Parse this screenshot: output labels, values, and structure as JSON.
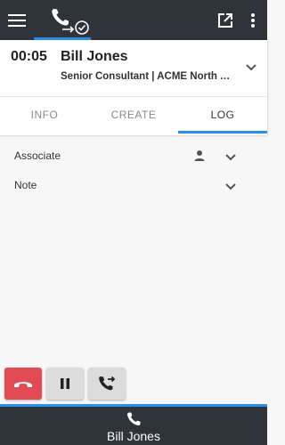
{
  "header": {
    "menu_icon": "hamburger-menu-icon",
    "phone_icon": "phone-check-icon",
    "popout_icon": "open-external-icon",
    "more_icon": "more-vertical-icon"
  },
  "call": {
    "timer": "00:05",
    "name": "Bill Jones",
    "subtitle": "Senior Consultant | ACME North A..."
  },
  "tabs": [
    {
      "label": "INFO"
    },
    {
      "label": "CREATE"
    },
    {
      "label": "LOG",
      "active": true
    }
  ],
  "log": {
    "associate_label": "Associate",
    "note_label": "Note"
  },
  "controls": {
    "hangup_color": "#e24a55",
    "hold_icon": "pause-icon",
    "transfer_icon": "phone-forward-icon"
  },
  "footer": {
    "name": "Bill Jones"
  },
  "colors": {
    "accent": "#2a8fe8",
    "bar": "#2f343b"
  }
}
